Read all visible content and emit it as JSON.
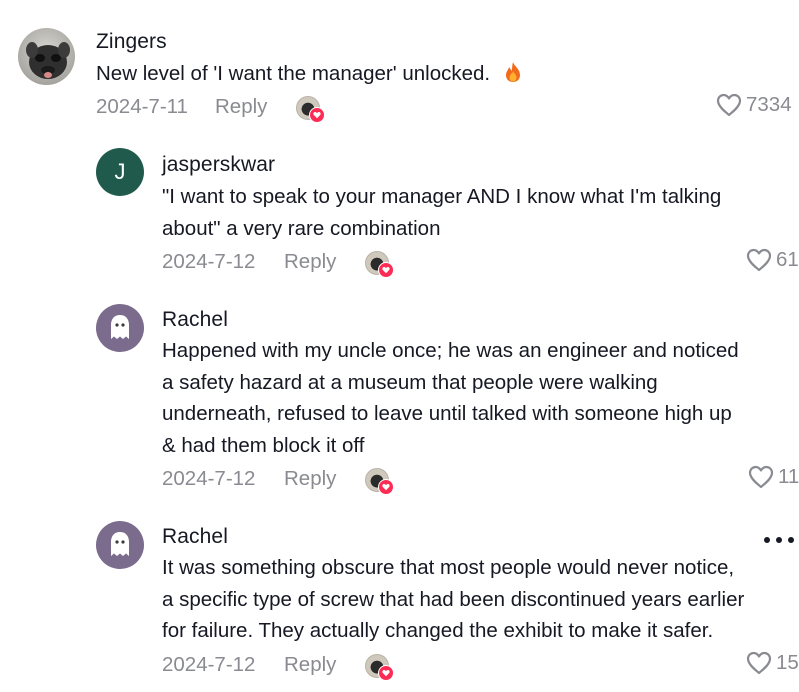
{
  "colors": {
    "text": "#161823",
    "secondary": "#8a8b91",
    "heart_badge": "#fe2c55",
    "jasper_avatar_bg": "#1f5a4d",
    "rachel_avatar_bg": "#7b6b8c"
  },
  "comments": [
    {
      "username": "Zingers",
      "lines": [
        "New level of 'I want the manager' unlocked."
      ],
      "emoji": "fire-icon",
      "date": "2024-7-11",
      "reply_label": "Reply",
      "likes": "7334",
      "avatar": "photo-avatar"
    },
    {
      "username": "jasperskwar",
      "avatar_letter": "J",
      "lines": [
        "\"I want to speak to your manager AND I know what I'm talking",
        "about\" a very rare combination"
      ],
      "date": "2024-7-12",
      "reply_label": "Reply",
      "likes": "61"
    },
    {
      "username": "Rachel",
      "avatar": "ghost-icon",
      "lines": [
        "Happened with my uncle once; he was an engineer and noticed",
        "a safety hazard at a museum that people were walking",
        "underneath, refused to leave until talked with someone high up",
        "& had them block it off"
      ],
      "date": "2024-7-12",
      "reply_label": "Reply",
      "likes": "11"
    },
    {
      "username": "Rachel",
      "avatar": "ghost-icon",
      "lines": [
        "It was something obscure that most people would never notice,",
        "a specific type of screw that had been discontinued years earlier",
        "for failure. They actually changed the exhibit to make it safer."
      ],
      "date": "2024-7-12",
      "reply_label": "Reply",
      "likes": "15"
    }
  ]
}
